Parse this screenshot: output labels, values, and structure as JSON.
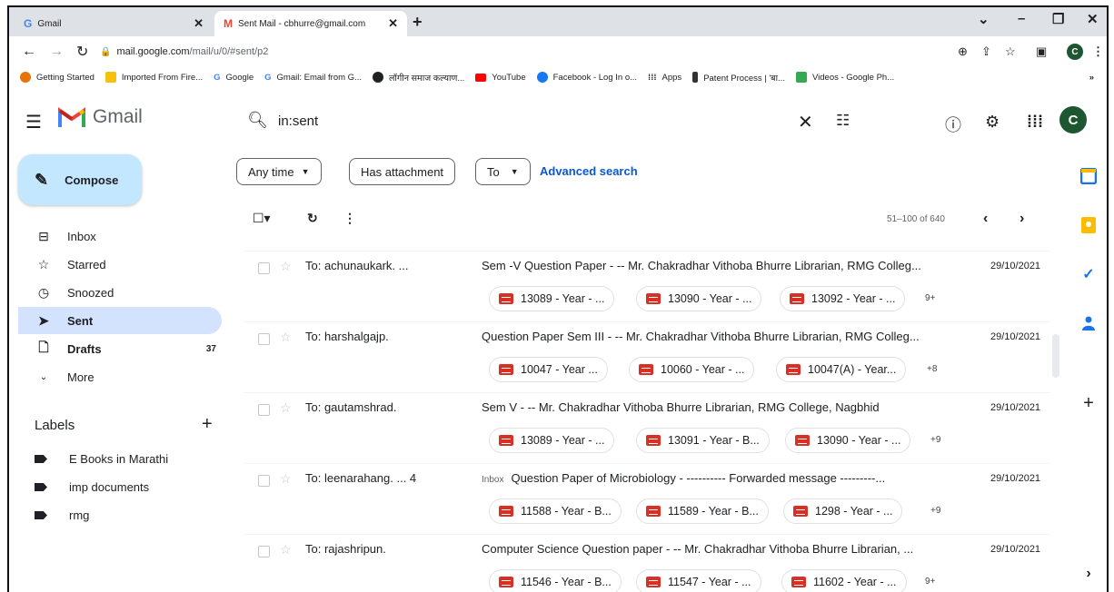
{
  "browser": {
    "tabs": [
      {
        "title": "Gmail",
        "active": false
      },
      {
        "title": "Sent Mail - cbhurre@gmail.com",
        "active": true
      }
    ],
    "new_tab": "+",
    "url_host": "mail.google.com",
    "url_path": "/mail/u/0/#sent/p2",
    "profile_initial": "C",
    "bookmarks": [
      {
        "label": "Getting Started",
        "color": "#e8710a"
      },
      {
        "label": "Imported From Fire...",
        "color": "#f4c20d"
      },
      {
        "label": "Google",
        "color": "#4285f4"
      },
      {
        "label": "Gmail: Email from G...",
        "color": "#4285f4"
      },
      {
        "label": "लॉगीन समाज कल्याण...",
        "color": "#202124"
      },
      {
        "label": "YouTube",
        "color": "#ff0000"
      },
      {
        "label": "Facebook - Log In o...",
        "color": "#1877f2"
      },
      {
        "label": "Apps",
        "color": "#202124"
      },
      {
        "label": "Patent Process | 'बा...",
        "color": "#333333"
      },
      {
        "label": "Videos - Google Ph...",
        "color": "#34a853"
      }
    ],
    "bookmarks_overflow": "»"
  },
  "gmail": {
    "logo_text": "Gmail",
    "search": {
      "value": "in:sent"
    },
    "avatar_initial": "C",
    "filters": {
      "any_time": "Any time",
      "has_attachment": "Has attachment",
      "to": "To",
      "advanced": "Advanced search"
    },
    "compose": "Compose",
    "nav": [
      {
        "label": "Inbox",
        "count": ""
      },
      {
        "label": "Starred",
        "count": ""
      },
      {
        "label": "Snoozed",
        "count": ""
      },
      {
        "label": "Sent",
        "count": ""
      },
      {
        "label": "Drafts",
        "count": "37"
      },
      {
        "label": "More",
        "count": ""
      }
    ],
    "labels_title": "Labels",
    "labels": [
      "E Books in Marathi",
      "imp documents",
      "rmg"
    ],
    "page_info": "51–100 of 640",
    "emails": [
      {
        "to": "To: achunaukark. ...",
        "tag": "",
        "subject": "Sem -V Question Paper - -- Mr. Chakradhar Vithoba Bhurre Librarian, RMG Colleg...",
        "date": "29/10/2021",
        "attachments": [
          "13089 - Year - ...",
          "13090 - Year - ...",
          "13092 - Year - ..."
        ],
        "more": "9+"
      },
      {
        "to": "To: harshalgajp.",
        "tag": "",
        "subject": "Question Paper Sem III - -- Mr. Chakradhar Vithoba Bhurre Librarian, RMG Colleg...",
        "date": "29/10/2021",
        "attachments": [
          "10047 - Year ...",
          "10060 - Year - ...",
          "10047(A) - Year..."
        ],
        "more": "+8"
      },
      {
        "to": "To: gautamshrad.",
        "tag": "",
        "subject": "Sem V - -- Mr. Chakradhar Vithoba Bhurre Librarian, RMG College, Nagbhid",
        "date": "29/10/2021",
        "attachments": [
          "13089 - Year - ...",
          "13091 - Year - B...",
          "13090 - Year - ..."
        ],
        "more": "+9"
      },
      {
        "to": "To: leenarahang. ... 4",
        "tag": "Inbox",
        "subject": "Question Paper of Microbiology - ---------- Forwarded message ---------...",
        "date": "29/10/2021",
        "attachments": [
          "11588 - Year - B...",
          "11589 - Year - B...",
          "1298 - Year - ..."
        ],
        "more": "+9"
      },
      {
        "to": "To: rajashripun.",
        "tag": "",
        "subject": "Computer Science Question paper - -- Mr. Chakradhar Vithoba Bhurre Librarian, ...",
        "date": "29/10/2021",
        "attachments": [
          "11546 - Year - B...",
          "11547 - Year - ...",
          "11602 - Year - ..."
        ],
        "more": "9+"
      }
    ]
  }
}
